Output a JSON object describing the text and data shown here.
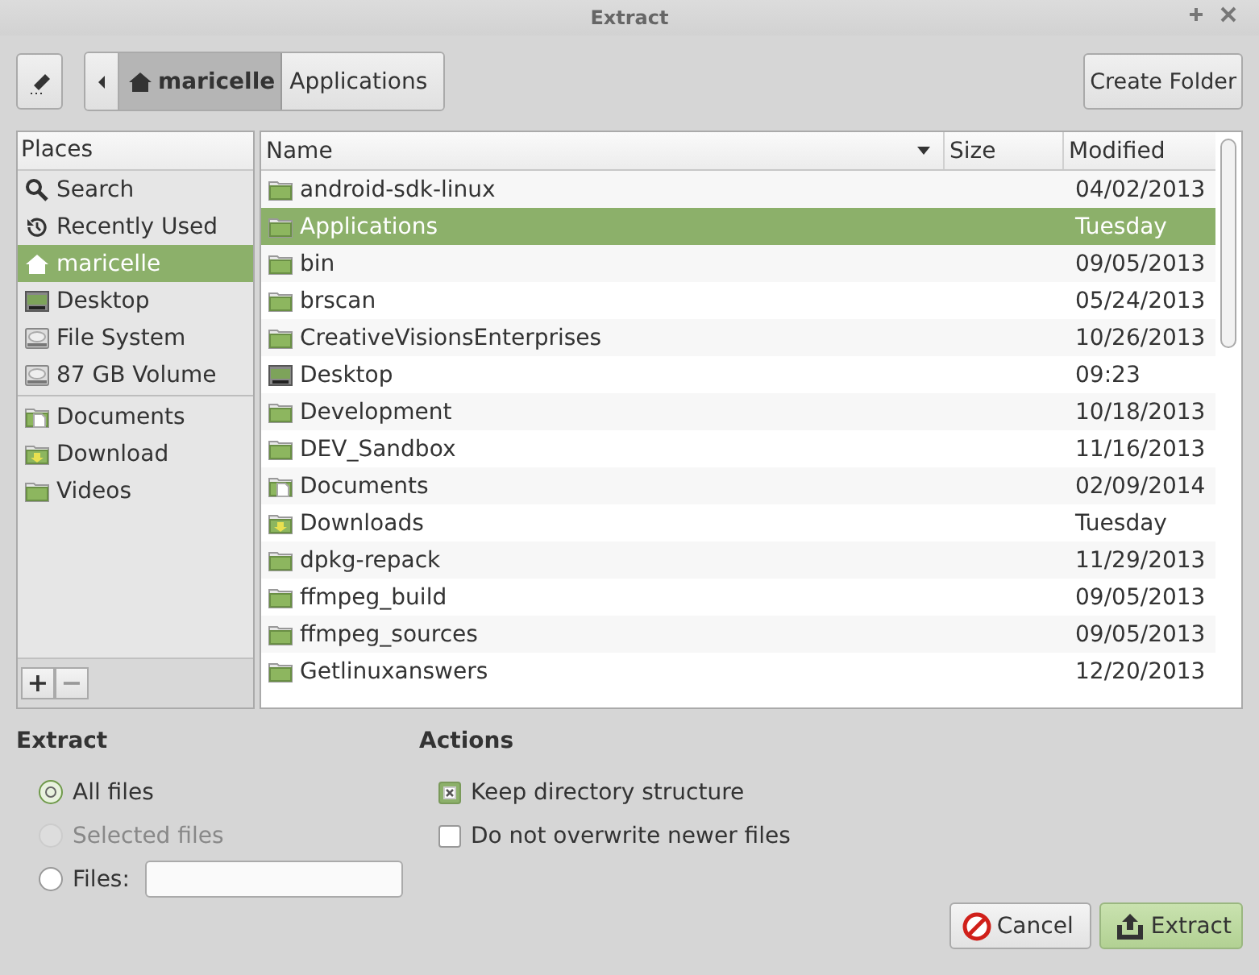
{
  "window": {
    "title": "Extract"
  },
  "toolbar": {
    "path": [
      {
        "label": "maricelle",
        "kind": "home",
        "selected": true
      },
      {
        "label": "Applications",
        "kind": "folder",
        "selected": false
      }
    ],
    "create_folder": "Create Folder"
  },
  "places": {
    "header": "Places",
    "groups": [
      [
        {
          "label": "Search",
          "kind": "search",
          "selected": false
        },
        {
          "label": "Recently Used",
          "kind": "recent",
          "selected": false
        },
        {
          "label": "maricelle",
          "kind": "home",
          "selected": true
        },
        {
          "label": "Desktop",
          "kind": "desktop",
          "selected": false
        },
        {
          "label": "File System",
          "kind": "drive",
          "selected": false
        },
        {
          "label": "87 GB Volume",
          "kind": "drive",
          "selected": false
        }
      ],
      [
        {
          "label": "Documents",
          "kind": "documents",
          "selected": false
        },
        {
          "label": "Download",
          "kind": "download",
          "selected": false
        },
        {
          "label": "Videos",
          "kind": "folder",
          "selected": false
        }
      ]
    ],
    "add": "+",
    "remove": "−"
  },
  "files": {
    "columns": [
      "Name",
      "Size",
      "Modified"
    ],
    "rows": [
      {
        "name": "android-sdk-linux",
        "kind": "folder",
        "modified": "04/02/2013",
        "selected": false
      },
      {
        "name": "Applications",
        "kind": "folder",
        "modified": "Tuesday",
        "selected": true
      },
      {
        "name": "bin",
        "kind": "folder",
        "modified": "09/05/2013",
        "selected": false
      },
      {
        "name": "brscan",
        "kind": "folder",
        "modified": "05/24/2013",
        "selected": false
      },
      {
        "name": "CreativeVisionsEnterprises",
        "kind": "folder",
        "modified": "10/26/2013",
        "selected": false
      },
      {
        "name": "Desktop",
        "kind": "desktop",
        "modified": "09:23",
        "selected": false
      },
      {
        "name": "Development",
        "kind": "folder",
        "modified": "10/18/2013",
        "selected": false
      },
      {
        "name": "DEV_Sandbox",
        "kind": "folder",
        "modified": "11/16/2013",
        "selected": false
      },
      {
        "name": "Documents",
        "kind": "documents",
        "modified": "02/09/2014",
        "selected": false
      },
      {
        "name": "Downloads",
        "kind": "download",
        "modified": "Tuesday",
        "selected": false
      },
      {
        "name": "dpkg-repack",
        "kind": "folder",
        "modified": "11/29/2013",
        "selected": false
      },
      {
        "name": "ffmpeg_build",
        "kind": "folder",
        "modified": "09/05/2013",
        "selected": false
      },
      {
        "name": "ffmpeg_sources",
        "kind": "folder",
        "modified": "09/05/2013",
        "selected": false
      },
      {
        "name": "Getlinuxanswers",
        "kind": "folder",
        "modified": "12/20/2013",
        "selected": false
      }
    ]
  },
  "extract": {
    "title": "Extract",
    "options": [
      {
        "label": "All files",
        "kind": "plain",
        "selected": true,
        "disabled": false
      },
      {
        "label": "Selected files",
        "kind": "plain",
        "selected": false,
        "disabled": true
      },
      {
        "label": "Files:",
        "kind": "field",
        "selected": false,
        "disabled": false
      }
    ]
  },
  "actions": {
    "title": "Actions",
    "options": [
      {
        "label": "Keep directory structure",
        "checked": true
      },
      {
        "label": "Do not overwrite newer files",
        "checked": false
      }
    ]
  },
  "buttons": [
    {
      "label": "Cancel",
      "kind": "cancel"
    },
    {
      "label": "Extract",
      "kind": "extract"
    }
  ]
}
